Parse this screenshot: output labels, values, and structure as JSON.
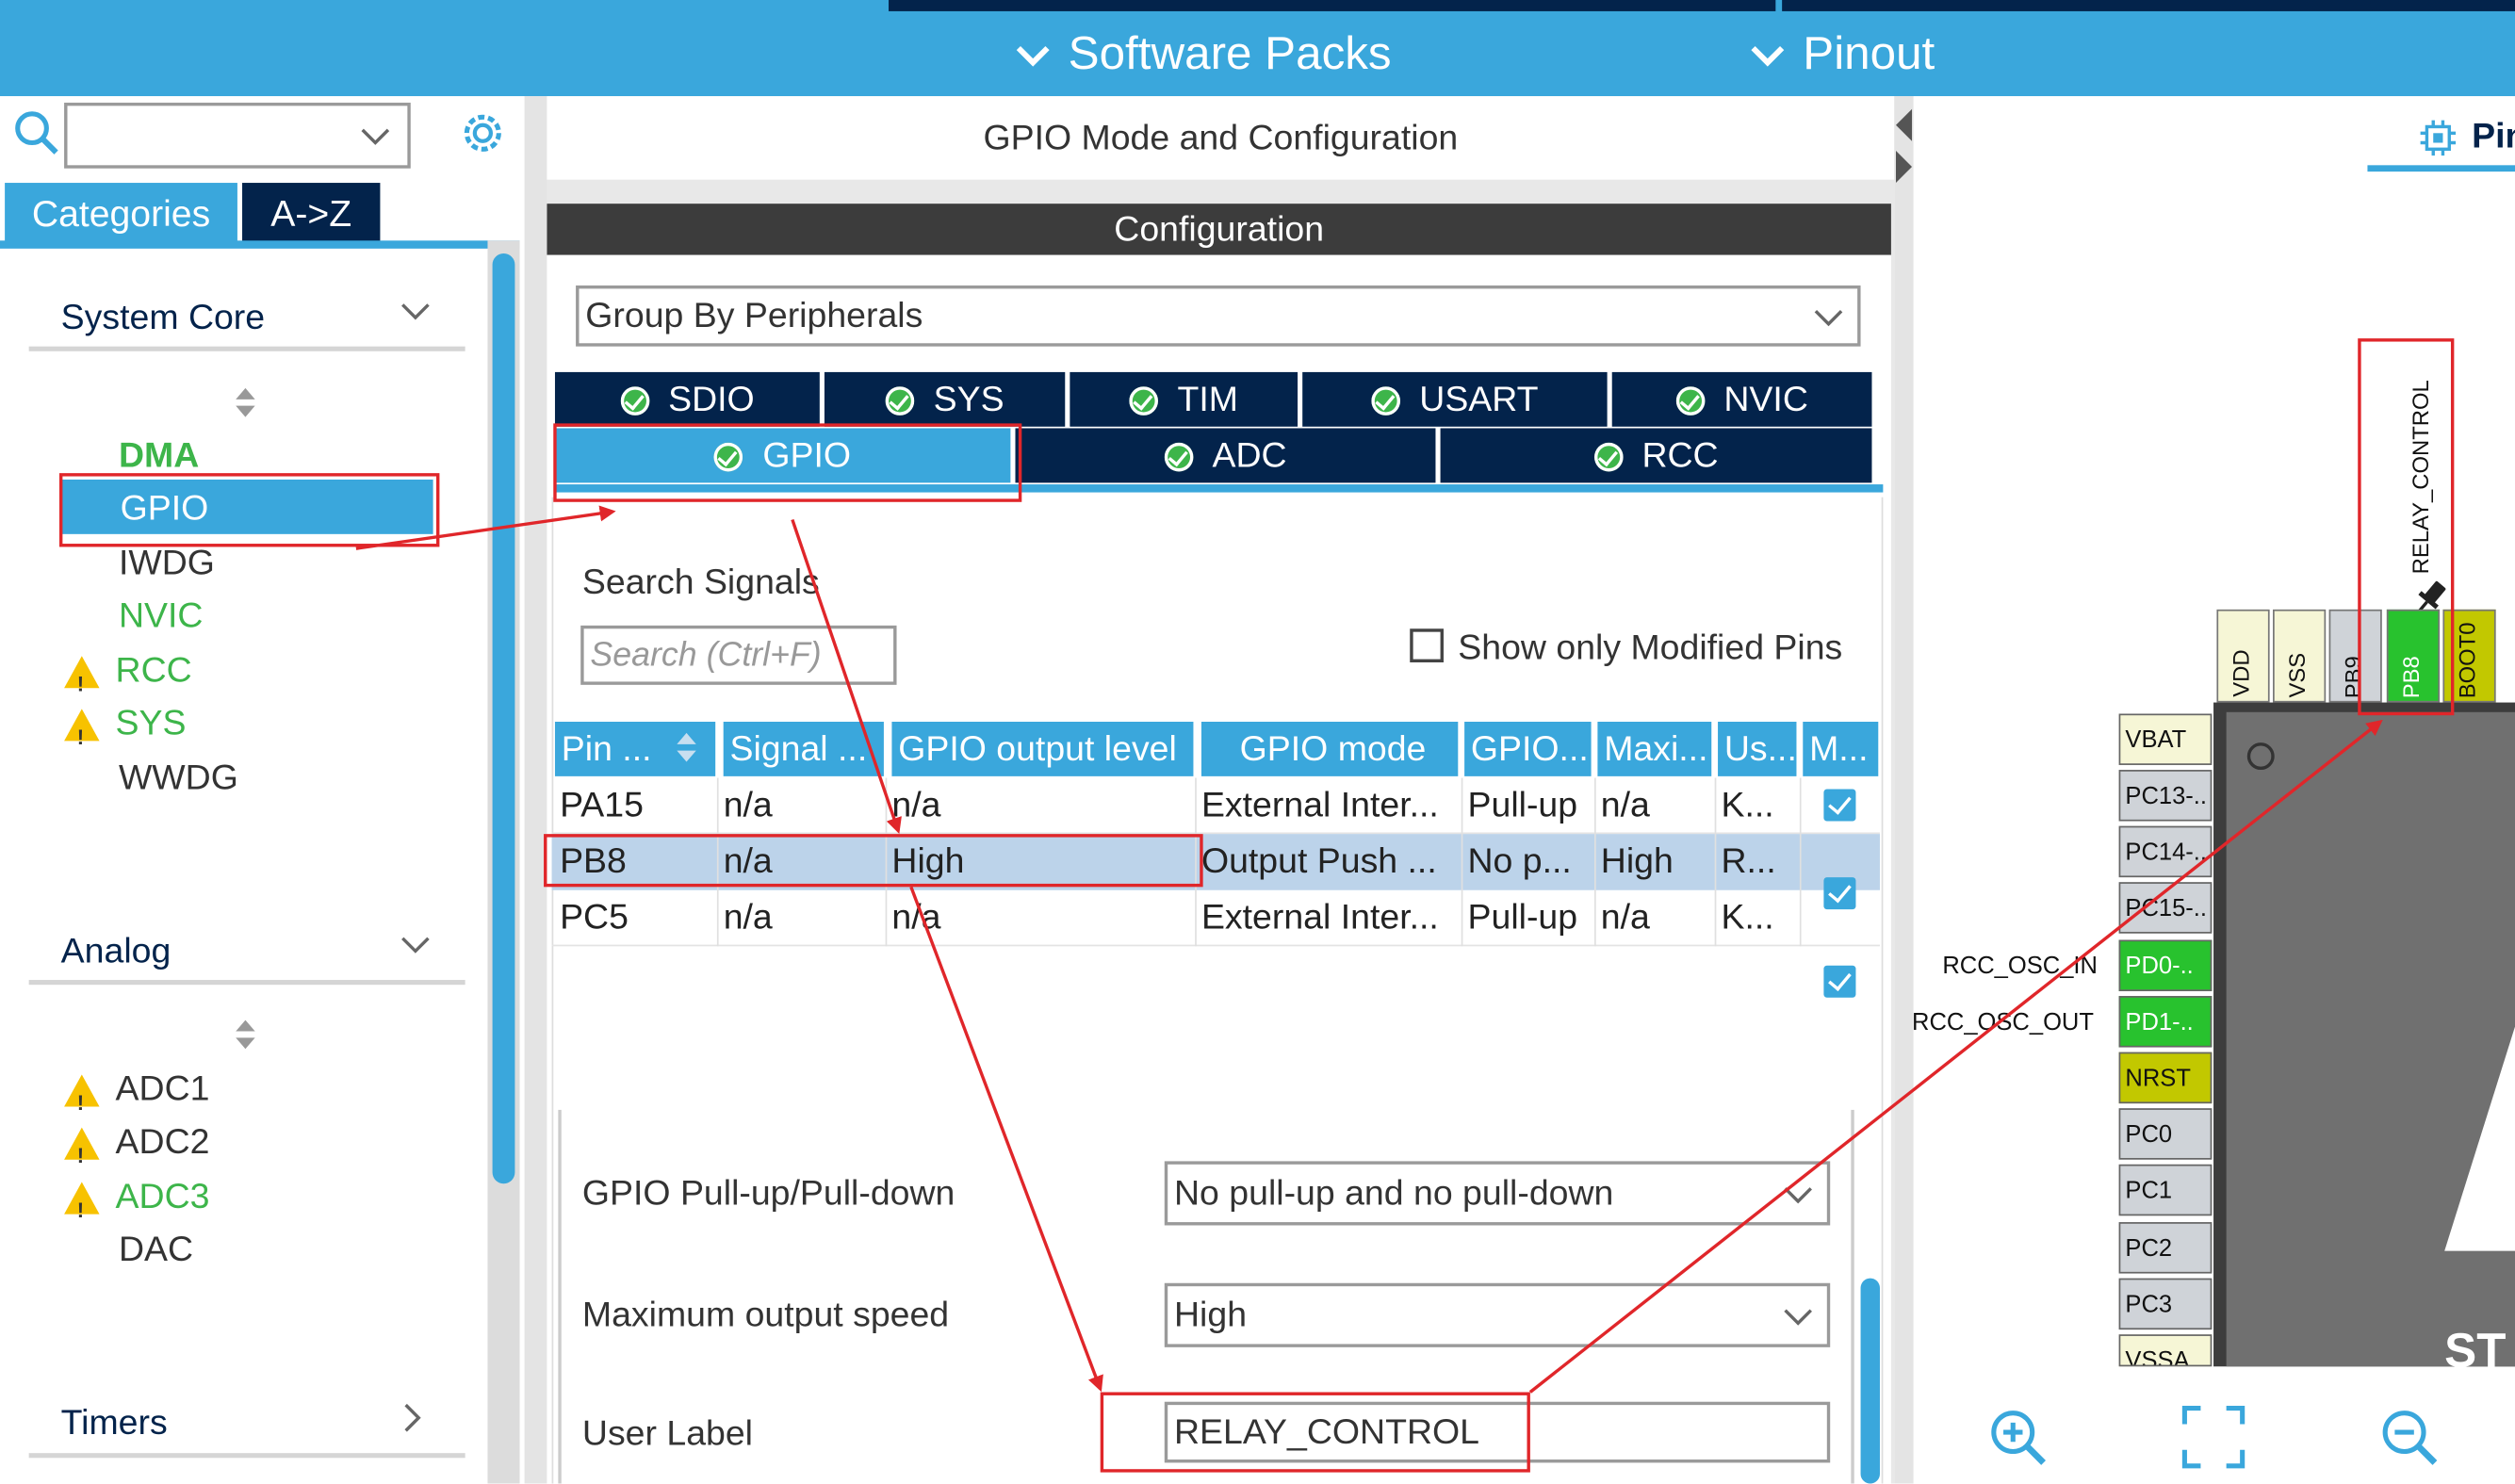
{
  "topbar": {
    "software_packs": "Software Packs",
    "pinout": "Pinout"
  },
  "left": {
    "tabs": {
      "categories": "Categories",
      "az": "A->Z"
    },
    "system_core": {
      "title": "System Core",
      "items": [
        {
          "label": "DMA",
          "color": "#3db54a",
          "warning": false
        },
        {
          "label": "GPIO",
          "color": "#ffffff",
          "warning": false
        },
        {
          "label": "IWDG",
          "color": "#333333",
          "warning": false
        },
        {
          "label": "NVIC",
          "color": "#3db54a",
          "warning": false
        },
        {
          "label": "RCC",
          "color": "#3db54a",
          "warning": true
        },
        {
          "label": "SYS",
          "color": "#3db54a",
          "warning": true
        },
        {
          "label": "WWDG",
          "color": "#333333",
          "warning": false
        }
      ]
    },
    "analog": {
      "title": "Analog",
      "items": [
        {
          "label": "ADC1",
          "warning": true
        },
        {
          "label": "ADC2",
          "warning": true
        },
        {
          "label": "ADC3",
          "warning": true
        },
        {
          "label": "DAC",
          "warning": false
        }
      ]
    },
    "timers": {
      "title": "Timers"
    }
  },
  "middle": {
    "header": "GPIO Mode and Configuration",
    "configuration": "Configuration",
    "group_by": "Group By Peripherals",
    "tabs_row1": [
      "SDIO",
      "SYS",
      "TIM",
      "USART",
      "NVIC"
    ],
    "tabs_row2": [
      "GPIO",
      "ADC",
      "RCC"
    ],
    "search_signals": "Search Signals",
    "search_placeholder": "Search (Ctrl+F)",
    "show_modified": "Show only Modified Pins",
    "table": {
      "headers": [
        "Pin ...",
        "Signal ...",
        "GPIO output level",
        "GPIO mode",
        "GPIO...",
        "Maxi...",
        "Us...",
        "M..."
      ],
      "rows": [
        [
          "PA15",
          "n/a",
          "n/a",
          "External Inter...",
          "Pull-up",
          "n/a",
          "K..."
        ],
        [
          "PB8",
          "n/a",
          "High",
          "Output Push ...",
          "No p...",
          "High",
          "R..."
        ],
        [
          "PC5",
          "n/a",
          "n/a",
          "External Inter...",
          "Pull-up",
          "n/a",
          "K..."
        ]
      ]
    },
    "fields": {
      "pull_label": "GPIO Pull-up/Pull-down",
      "pull_value": "No pull-up and no pull-down",
      "speed_label": "Maximum output speed",
      "speed_value": "High",
      "user_label": "User Label",
      "user_value": "RELAY_CONTROL"
    }
  },
  "right": {
    "tab_label": "Pin",
    "relay_label": "RELAY_CONTROL",
    "top_pins": [
      "VDD",
      "VSS",
      "PB9",
      "PB8",
      "BOOT0"
    ],
    "left_pins": [
      "VBAT",
      "PC13-..",
      "PC14-..",
      "PC15-..",
      "PD0-..",
      "PD1-..",
      "NRST",
      "PC0",
      "PC1",
      "PC2",
      "PC3",
      "VSSA"
    ],
    "left_labels": [
      "RCC_OSC_IN",
      "RCC_OSC_OUT"
    ],
    "chip_text": "ST"
  }
}
